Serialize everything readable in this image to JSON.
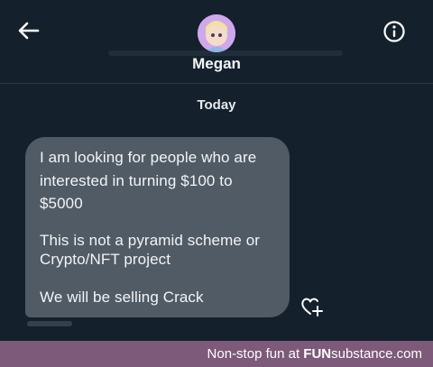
{
  "header": {
    "contact_name": "Megan",
    "back_icon": "arrow-left-icon",
    "info_icon": "info-circle-icon"
  },
  "conversation": {
    "date_label": "Today",
    "message": {
      "lines": [
        "I am looking for people who are",
        "interested in turning $100 to",
        "$5000",
        "",
        "This is not a pyramid scheme or",
        "Crypto/NFT project",
        "",
        "We will be selling Crack"
      ]
    },
    "react_icon": "heart-plus-icon"
  },
  "watermark": {
    "prefix": "Non-stop fun at ",
    "brand_bold": "FUN",
    "brand_rest": "substance.com"
  },
  "colors": {
    "background": "#14202c",
    "bubble": "#515b66",
    "watermark_bar": "#7d5a7a"
  }
}
